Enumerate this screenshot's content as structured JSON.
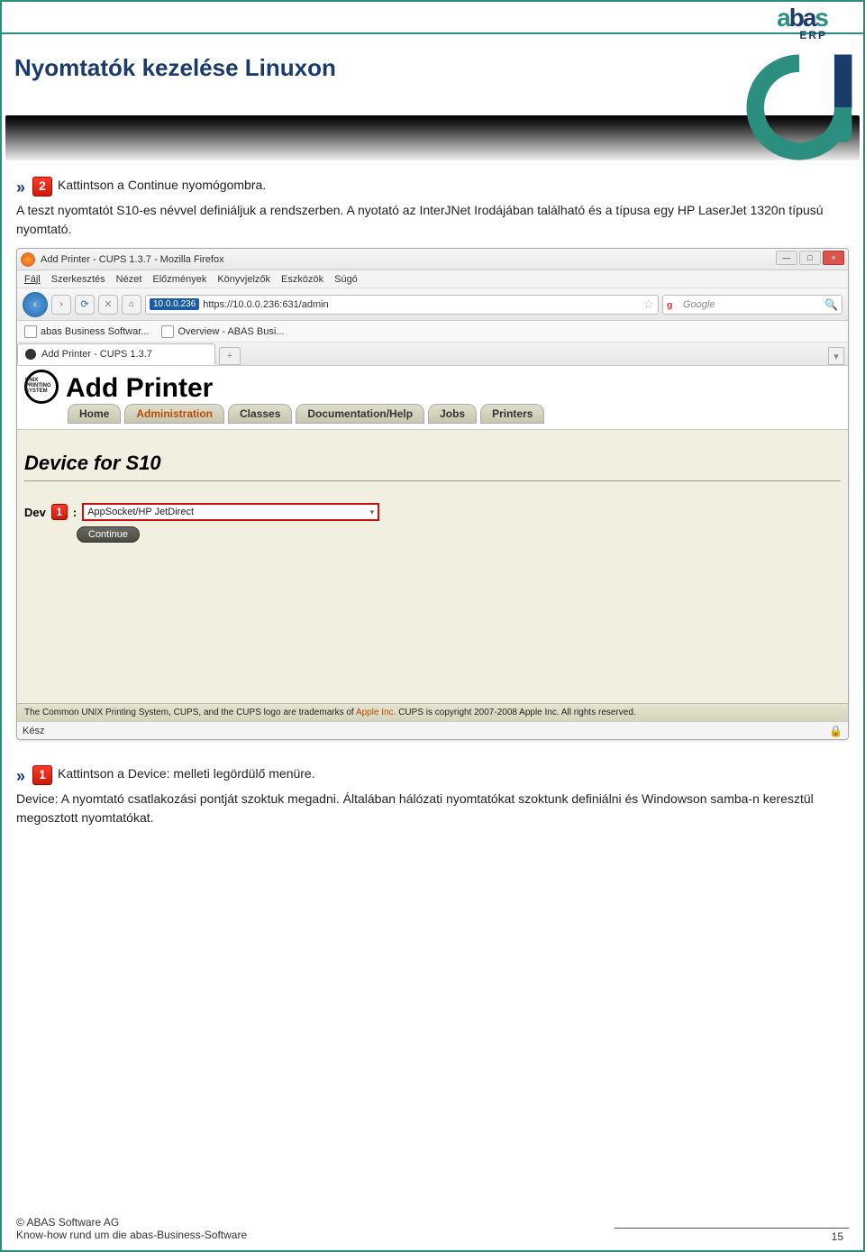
{
  "banner": {
    "title": "Nyomtatók kezelése Linuxon",
    "logo_brand": {
      "a": "a",
      "b": "ba",
      "s": "s"
    },
    "logo_sub": "ERP"
  },
  "section1": {
    "bullet_arrow": "»",
    "step_num": "2",
    "step_text": " Kattintson a Continue nyomógombra.",
    "para": "A teszt nyomtatót S10-es névvel definiáljuk a rendszerben. A nyotató az InterJNet Irodájában található és a típusa egy HP LaserJet 1320n típusú nyomtató."
  },
  "firefox": {
    "title": "Add Printer - CUPS 1.3.7 - Mozilla Firefox",
    "win_min": "—",
    "win_max": "□",
    "win_close": "×",
    "menu": {
      "fajl": "Fájl",
      "szerk": "Szerkesztés",
      "nezet": "Nézet",
      "eloz": "Előzmények",
      "konyv": "Könyvjelzők",
      "eszk": "Eszközök",
      "sugo": "Súgó"
    },
    "nav_back": "‹",
    "nav_fwd": "›",
    "nav_reload": "⟳",
    "nav_stop": "✕",
    "nav_home": "⌂",
    "url_chip": "10.0.0.236",
    "url_text": "https://10.0.0.236:631/admin",
    "star": "☆",
    "search_placeholder": "Google",
    "search_mag": "🔍",
    "bookmarks": {
      "bm1": "abas Business Softwar...",
      "bm2": "Overview - ABAS Busi..."
    },
    "tab": {
      "label": "Add Printer - CUPS 1.3.7",
      "plus": "+",
      "down": "▾"
    },
    "status": "Kész",
    "lock": "🔒"
  },
  "cups": {
    "logo_text": "UNIX PRINTING SYSTEM",
    "title": "Add Printer",
    "nav": {
      "home": "Home",
      "admin": "Administration",
      "classes": "Classes",
      "docs": "Documentation/Help",
      "jobs": "Jobs",
      "printers": "Printers"
    },
    "section_title": "Device for S10",
    "label_l": "Dev",
    "label_r": ":",
    "step_num": "1",
    "select_value": "AppSocket/HP JetDirect",
    "select_arrow": "▾",
    "continue": "Continue",
    "footer_pre": "The Common UNIX Printing System, CUPS, and the CUPS logo are trademarks of ",
    "footer_apple": "Apple Inc.",
    "footer_post": " CUPS is copyright 2007-2008 Apple Inc. All rights reserved."
  },
  "section2": {
    "bullet_arrow": "»",
    "step_num": "1",
    "step_text": " Kattintson a Device: melleti legördülő menüre.",
    "para": "Device: A nyomtató csatlakozási pontját szoktuk megadni. Általában hálózati nyomtatókat szoktunk definiálni és Windowson samba-n keresztül megosztott nyomtatókat."
  },
  "footer": {
    "page_num": "15",
    "copyright": "© ABAS Software AG",
    "tagline": "Know-how rund um die abas-Business-Software"
  }
}
